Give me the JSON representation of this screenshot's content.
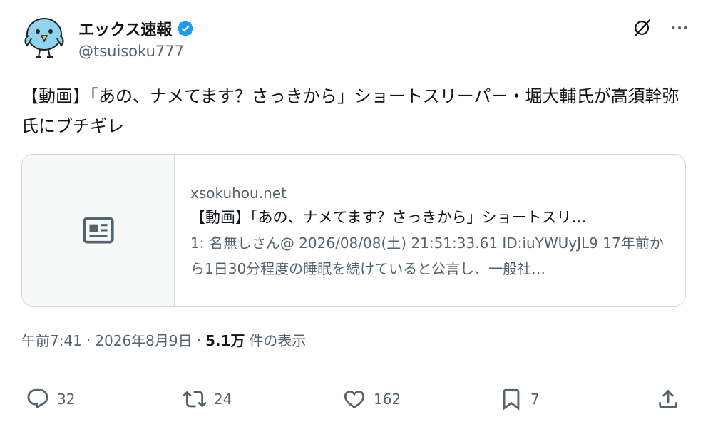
{
  "user": {
    "display_name": "エックス速報",
    "handle": "@tsuisoku777",
    "verified": true,
    "avatar_icon": "bird-avatar-icon"
  },
  "tweet": {
    "text": "【動画】「あの、ナメてます？さっきから」ショートスリーパー・堀大輔氏が高須幹弥氏にブチギレ"
  },
  "card": {
    "domain": "xsokuhou.net",
    "title": "【動画】「あの、ナメてます？さっきから」ショートスリ…",
    "description": "1: 名無しさん@ 2026/08/08(土) 21:51:33.61 ID:iuYWUyJL9 17年前から1日30分程度の睡眠を続けていると公言し、一般社…",
    "thumb_icon": "article-icon"
  },
  "meta": {
    "time": "午前7:41",
    "separator": "·",
    "date": "2026年8月9日",
    "views_count": "5.1万",
    "views_label": "件の表示"
  },
  "actions": {
    "replies": "32",
    "reposts": "24",
    "likes": "162",
    "bookmarks": "7"
  },
  "colors": {
    "verified": "#1d9bf0",
    "secondary_text": "#536471",
    "primary_text": "#0f1419",
    "border": "#cfd9de"
  }
}
